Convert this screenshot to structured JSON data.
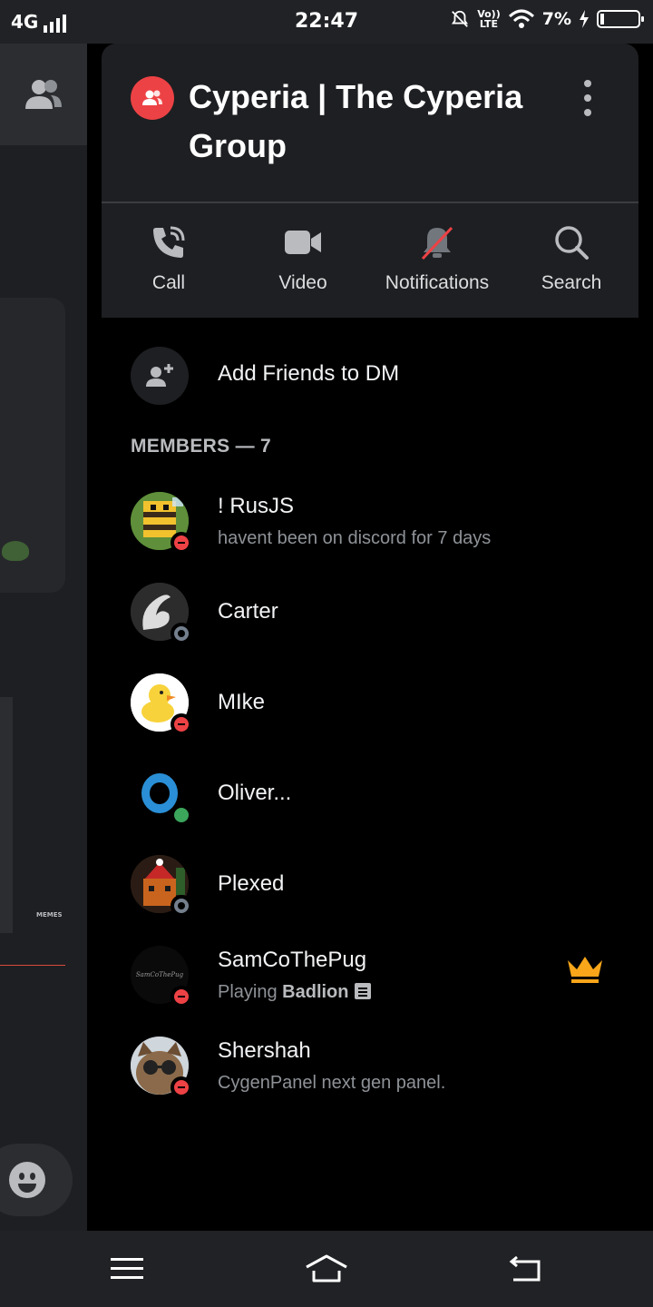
{
  "status_bar": {
    "network": "4G",
    "time": "22:47",
    "volte_top": "Vo))",
    "volte_bottom": "LTE",
    "battery": "7%"
  },
  "background": {
    "memes_text": "MEMES"
  },
  "panel": {
    "group_name": "Cyperia | The Cyperia Group",
    "actions": [
      {
        "label": "Call",
        "icon": "call-icon"
      },
      {
        "label": "Video",
        "icon": "video-icon"
      },
      {
        "label": "Notifications",
        "icon": "bell-muted-icon"
      },
      {
        "label": "Search",
        "icon": "search-icon"
      }
    ],
    "add_friends_label": "Add Friends to DM",
    "members_header": "MEMBERS — 7",
    "members": [
      {
        "name": "! RusJS",
        "sub": "havent been on discord for 7 days",
        "status": "dnd"
      },
      {
        "name": "Carter",
        "status": "offline"
      },
      {
        "name": "MIke",
        "status": "dnd"
      },
      {
        "name": "Oliver...",
        "status": "online"
      },
      {
        "name": "Plexed",
        "status": "offline"
      },
      {
        "name": "SamCoThePug",
        "sub_prefix": "Playing ",
        "sub_game": "Badlion",
        "status": "dnd",
        "owner": true,
        "avatar_text": "SamCoThePug"
      },
      {
        "name": "Shershah",
        "sub": "CygenPanel next gen panel.",
        "status": "dnd"
      }
    ]
  },
  "colors": {
    "dnd": "#ed4245",
    "online": "#3ba55c",
    "offline": "#747f8d",
    "crown": "#faa61a",
    "group_icon": "#ed4245"
  }
}
